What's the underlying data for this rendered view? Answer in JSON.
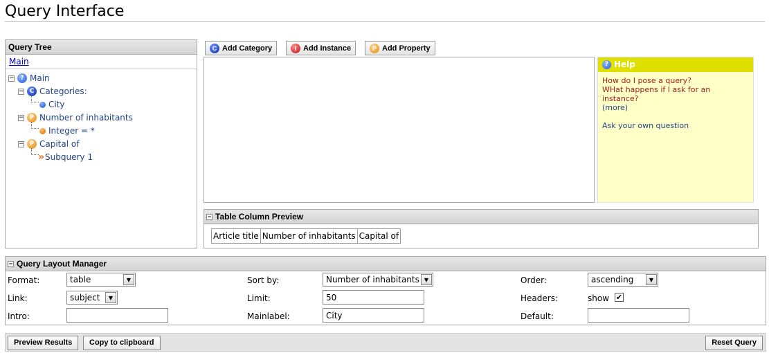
{
  "page": {
    "title": "Query Interface"
  },
  "tree": {
    "header": "Query Tree",
    "breadcrumb": "Main",
    "nodes": {
      "main": "Main",
      "categories": "Categories:",
      "city": "City",
      "inhabitants": "Number of inhabitants",
      "integer": "Integer = *",
      "capital": "Capital of",
      "subquery": "Subquery 1"
    }
  },
  "toolbar": {
    "add_category": "Add Category",
    "add_instance": "Add Instance",
    "add_property": "Add Property"
  },
  "icons": {
    "category": "category-icon (C)",
    "instance": "instance-icon (I)",
    "property": "property-icon (P)",
    "help": "help-icon (?)"
  },
  "help": {
    "title": "Help",
    "question1": "How do I pose a query?",
    "question2": "WHat happens if I ask for an instance?",
    "more": "(more)",
    "ask": "Ask your own question"
  },
  "preview": {
    "title": "Table Column Preview",
    "columns": [
      "Article title",
      "Number of inhabitants",
      "Capital of"
    ]
  },
  "layout_manager": {
    "title": "Query Layout Manager",
    "format_label": "Format:",
    "format_value": "table",
    "link_label": "Link:",
    "link_value": "subject",
    "intro_label": "Intro:",
    "intro_value": "",
    "sortby_label": "Sort by:",
    "sortby_value": "Number of inhabitants",
    "limit_label": "Limit:",
    "limit_value": "50",
    "mainlabel_label": "Mainlabel:",
    "mainlabel_value": "City",
    "order_label": "Order:",
    "order_value": "ascending",
    "headers_label": "Headers:",
    "headers_value": "show",
    "headers_checked": true,
    "default_label": "Default:",
    "default_value": ""
  },
  "footer": {
    "preview_results": "Preview Results",
    "copy_clipboard": "Copy to clipboard",
    "reset_query": "Reset Query"
  },
  "colors": {
    "help_header": "#e0e000",
    "help_background": "#ffffc8",
    "link": "#0000cc",
    "tree_text": "#224488"
  }
}
